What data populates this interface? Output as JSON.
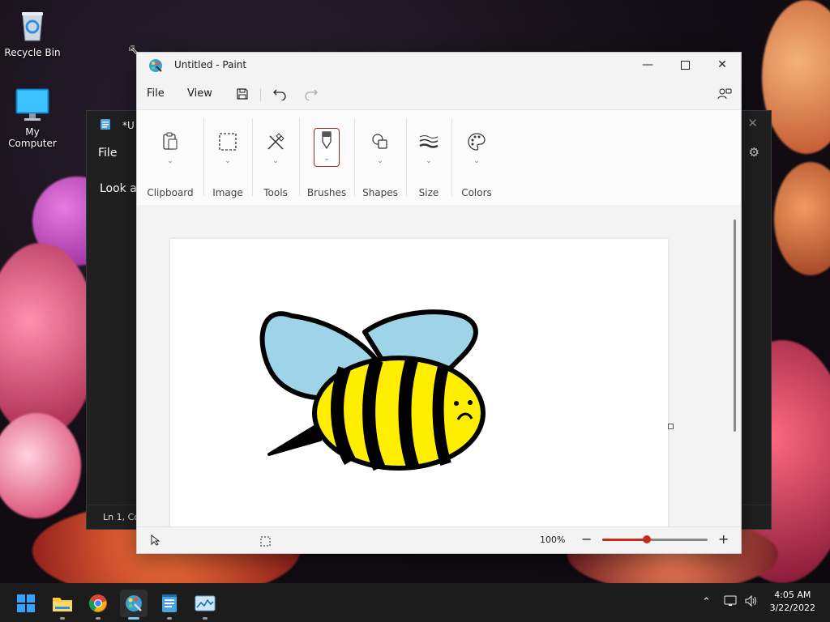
{
  "desktop": {
    "icons": [
      {
        "label": "Recycle Bin"
      },
      {
        "label": "My Computer"
      }
    ]
  },
  "notepad": {
    "title": "*U",
    "menu_file": "File",
    "text_fragment": "Look a",
    "status": "Ln 1, Co"
  },
  "paint": {
    "title": "Untitled - Paint",
    "menu": {
      "file": "File",
      "view": "View"
    },
    "ribbon": [
      {
        "label": "Clipboard",
        "icon": "clipboard-icon"
      },
      {
        "label": "Image",
        "icon": "selection-icon"
      },
      {
        "label": "Tools",
        "icon": "tools-icon"
      },
      {
        "label": "Brushes",
        "icon": "brush-icon"
      },
      {
        "label": "Shapes",
        "icon": "shapes-icon"
      },
      {
        "label": "Size",
        "icon": "size-icon"
      },
      {
        "label": "Colors",
        "icon": "palette-icon"
      }
    ],
    "status": {
      "zoom": "100%",
      "zoom_level_fraction": 0.42
    },
    "colors": {
      "accent": "#c42b1c",
      "bee_yellow": "#ffee00",
      "wing_blue": "#9fd3e8"
    }
  },
  "taskbar": {
    "apps": [
      "start-icon",
      "file-explorer-icon",
      "chrome-icon",
      "paint-icon",
      "notepad-icon",
      "task-manager-icon"
    ],
    "time": "4:05 AM",
    "date": "3/22/2022"
  }
}
